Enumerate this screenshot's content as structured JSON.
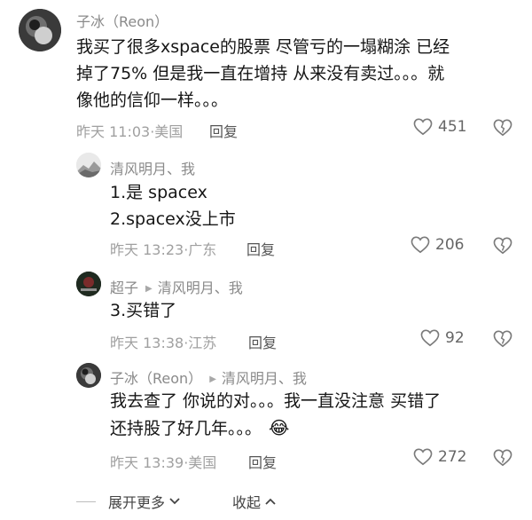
{
  "comments": [
    {
      "author": "子冰（Reon）",
      "lines": [
        "我买了很多xspace的股票 尽管亏的一塌糊涂 已经",
        "掉了75% 但是我一直在增持 从来没有卖过。。。就",
        "像他的信仰一样。。。"
      ],
      "meta": "昨天 11:03·美国",
      "reply_label": "回复",
      "likes": "451"
    },
    {
      "author": "清风明月、我",
      "lines": [
        "1.是 spacex",
        "2.spacex没上市"
      ],
      "meta": "昨天 13:23·广东",
      "reply_label": "回复",
      "likes": "206"
    },
    {
      "author": "超子",
      "reply_to": "清风明月、我",
      "lines": [
        "3.买错了"
      ],
      "meta": "昨天 13:38·江苏",
      "reply_label": "回复",
      "likes": "92"
    },
    {
      "author": "子冰（Reon）",
      "reply_to": "清风明月、我",
      "lines": [
        "我去查了 你说的对。。。我一直没注意 买错了",
        "还持股了好几年。。。"
      ],
      "emoji": "😂",
      "meta": "昨天 13:39·美国",
      "reply_label": "回复",
      "likes": "272"
    }
  ],
  "footer": {
    "expand_label": "展开更多",
    "collapse_label": "收起"
  },
  "icons": [
    "heart-icon",
    "dislike-heart-icon",
    "chevron-down-icon",
    "chevron-up-icon",
    "reply-arrow-icon"
  ]
}
